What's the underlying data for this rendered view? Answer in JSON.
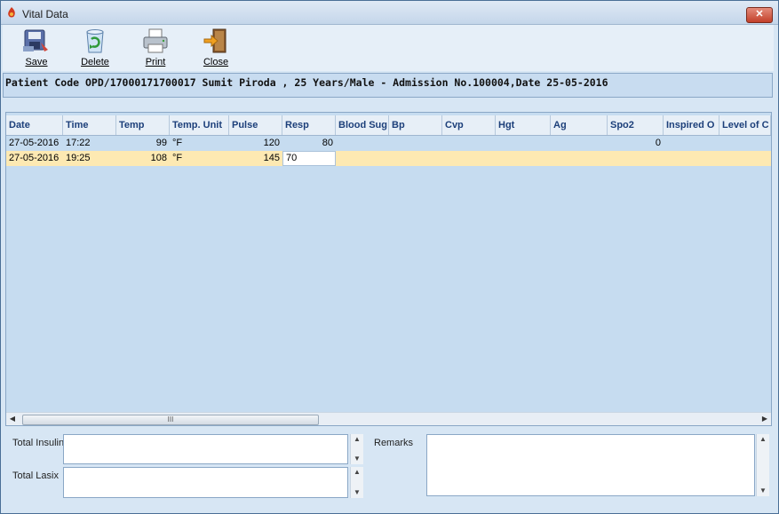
{
  "window": {
    "title": "Vital Data",
    "close_label": "✕"
  },
  "toolbar": {
    "save_label": "Save",
    "delete_label": "Delete",
    "print_label": "Print",
    "close_label": "Close"
  },
  "patient": {
    "info": "Patient Code OPD/17000171700017 Sumit Piroda , 25 Years/Male - Admission No.100004,Date 25-05-2016"
  },
  "grid": {
    "columns": [
      "Date",
      "Time",
      "Temp",
      "Temp. Unit",
      "Pulse",
      "Resp",
      "Blood Sug",
      "Bp",
      "Cvp",
      "Hgt",
      "Ag",
      "Spo2",
      "Inspired O",
      "Level of C"
    ],
    "rows": [
      {
        "date": "27-05-2016",
        "time": "17:22",
        "temp": "99",
        "temp_unit": "°F",
        "pulse": "120",
        "resp": "80",
        "spo2": "0"
      },
      {
        "date": "27-05-2016",
        "time": "19:25",
        "temp": "108",
        "temp_unit": "°F",
        "pulse": "145",
        "resp": "70"
      }
    ],
    "scroll_thumb": "III"
  },
  "bottom": {
    "total_insulin_label": "Total Insulin",
    "total_lasix_label": "Total Lasix",
    "remarks_label": "Remarks"
  },
  "colors": {
    "background": "#c8dcf0",
    "header_text": "#1c3f7a",
    "selected_row": "#fde9b2"
  }
}
